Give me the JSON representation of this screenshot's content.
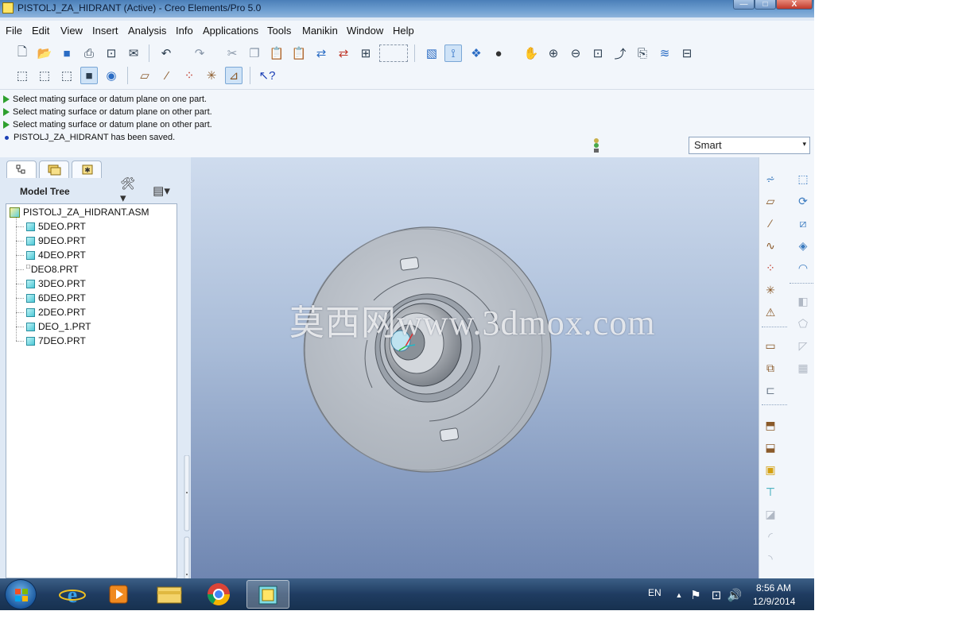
{
  "window": {
    "title": "PISTOLJ_ZA_HIDRANT (Active) - Creo Elements/Pro 5.0",
    "close_glyph": "X"
  },
  "menu": [
    "File",
    "Edit",
    "View",
    "Insert",
    "Analysis",
    "Info",
    "Applications",
    "Tools",
    "Manikin",
    "Window",
    "Help"
  ],
  "toolbar_icons": {
    "row1": [
      "new-icon",
      "open-icon",
      "save-icon",
      "print-icon",
      "print-preview-icon",
      "email-icon",
      "undo-icon",
      "redo-icon",
      "cut-icon",
      "copy-icon",
      "paste-icon",
      "paste-special-icon",
      "regenerate-icon",
      "regenerate-manager-icon",
      "find-icon",
      "select-box-icon",
      "repaint-icon",
      "spin-center-icon",
      "orient-mode-icon",
      "appearance-icon",
      "pan-icon",
      "zoom-in-icon",
      "zoom-out-icon",
      "refit-icon",
      "reorient-icon",
      "saved-views-icon",
      "layers-icon",
      "view-manager-icon"
    ],
    "row2": [
      "wireframe-icon",
      "hidden-line-icon",
      "no-hidden-icon",
      "shading-icon",
      "enhanced-realism-icon",
      "datum-planes-icon",
      "datum-axes-icon",
      "datum-points-icon",
      "coordinate-systems-icon",
      "annotation-display-icon",
      "context-help-icon"
    ]
  },
  "messages": [
    {
      "type": "prompt",
      "text": "Select mating surface or datum plane on one part."
    },
    {
      "type": "prompt",
      "text": "Select mating surface or datum plane on other part."
    },
    {
      "type": "prompt",
      "text": "Select mating surface or datum plane on other part."
    },
    {
      "type": "info",
      "text": "PISTOLJ_ZA_HIDRANT has been saved."
    }
  ],
  "filter": {
    "value": "Smart",
    "caret": "▾"
  },
  "model_tree": {
    "title": "Model Tree",
    "root": "PISTOLJ_ZA_HIDRANT.ASM",
    "items": [
      "5DEO.PRT",
      "9DEO.PRT",
      "4DEO.PRT",
      "DEO8.PRT",
      "3DEO.PRT",
      "6DEO.PRT",
      "2DEO.PRT",
      "DEO_1.PRT",
      "7DEO.PRT"
    ],
    "deo8_marker": "□"
  },
  "graphics": {
    "watermark": "莫西网www.3dmox.com",
    "background_top": "#cfdcee",
    "background_bottom": "#6f86b1"
  },
  "right_toolbar": {
    "col1": [
      "datum-plane-tool-icon",
      "sketch-plane-icon",
      "datum-axis-tool-icon",
      "datum-curve-icon",
      "datum-point-tool-icon",
      "coordinate-system-tool-icon",
      "analysis-feature-icon",
      "component-placement-icon",
      "assemble-icon",
      "create-component-icon",
      "repeat-icon",
      "package-icon",
      "include-icon",
      "flexible-icon",
      "remove-icon",
      "round-icon",
      "shell-icon",
      "draft-icon"
    ],
    "col2": [
      "hole-icon",
      "revolve-icon",
      "extrude-icon",
      "sweep-icon",
      "blend-icon",
      "mirror-icon",
      "merge-icon",
      "trim-icon",
      "pattern-icon"
    ]
  },
  "taskbar": {
    "apps": [
      "internet-explorer-icon",
      "media-player-icon",
      "file-explorer-icon",
      "chrome-icon",
      "creo-icon"
    ],
    "language": "EN",
    "time": "8:56 AM",
    "date": "12/9/2014"
  }
}
